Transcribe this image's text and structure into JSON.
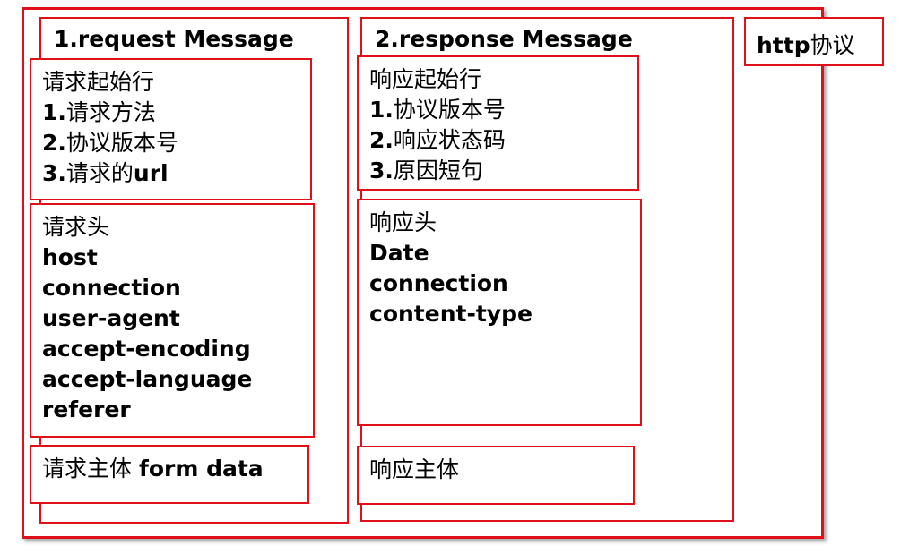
{
  "outer_frame": {},
  "request": {
    "title": "1.request Message",
    "start_line": {
      "heading": "请求起始行",
      "items": [
        {
          "num": "1.",
          "text": "请求方法"
        },
        {
          "num": "2.",
          "text": "协议版本号"
        },
        {
          "num": "3.",
          "text": "请求的",
          "suffix": "url"
        }
      ]
    },
    "headers": {
      "heading": "请求头",
      "items": [
        "host",
        "connection",
        "user-agent",
        "accept-encoding",
        "accept-language",
        "referer"
      ]
    },
    "body": {
      "label": "请求主体 ",
      "suffix": "form data"
    }
  },
  "response": {
    "title": "2.response Message",
    "start_line": {
      "heading": "响应起始行",
      "items": [
        {
          "num": "1.",
          "text": "协议版本号"
        },
        {
          "num": "2.",
          "text": "响应状态码"
        },
        {
          "num": "3.",
          "text": "原因短句"
        }
      ]
    },
    "headers": {
      "heading": "响应头",
      "items": [
        "Date",
        "connection",
        "content-type"
      ]
    },
    "body": {
      "label": "响应主体"
    }
  },
  "protocol_label": {
    "bold": "http",
    "text": "协议"
  },
  "colors": {
    "border": "#e0101a",
    "text": "#000000"
  }
}
